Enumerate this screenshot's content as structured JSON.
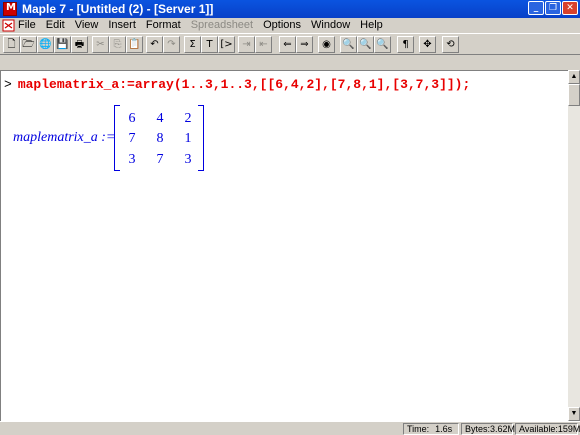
{
  "window": {
    "title": "Maple 7 - [Untitled (2) - [Server 1]]",
    "min_glyph": "_",
    "max_glyph": "❐",
    "close_glyph": "✕"
  },
  "menubar": {
    "items": [
      {
        "label": "File",
        "enabled": true
      },
      {
        "label": "Edit",
        "enabled": true
      },
      {
        "label": "View",
        "enabled": true
      },
      {
        "label": "Insert",
        "enabled": true
      },
      {
        "label": "Format",
        "enabled": true
      },
      {
        "label": "Spreadsheet",
        "enabled": false
      },
      {
        "label": "Options",
        "enabled": true
      },
      {
        "label": "Window",
        "enabled": true
      },
      {
        "label": "Help",
        "enabled": true
      }
    ]
  },
  "toolbar": {
    "tools": [
      {
        "name": "new-icon",
        "glyph": "🗋"
      },
      {
        "name": "open-icon",
        "glyph": "🗁"
      },
      {
        "name": "open-url-icon",
        "glyph": "🌐"
      },
      {
        "name": "save-icon",
        "glyph": "💾"
      },
      {
        "name": "print-icon",
        "glyph": "🖶"
      },
      {
        "name": "cut-icon",
        "glyph": "✂"
      },
      {
        "name": "copy-icon",
        "glyph": "⎘"
      },
      {
        "name": "paste-icon",
        "glyph": "📋"
      },
      {
        "name": "undo-icon",
        "glyph": "↶"
      },
      {
        "name": "redo-icon",
        "glyph": "↷"
      },
      {
        "name": "math-input-icon",
        "glyph": "Σ"
      },
      {
        "name": "text-input-icon",
        "glyph": "T"
      },
      {
        "name": "insert-prompt-icon",
        "glyph": "[>"
      },
      {
        "name": "indent-icon",
        "glyph": "⇥"
      },
      {
        "name": "outdent-icon",
        "glyph": "⇤"
      },
      {
        "name": "back-icon",
        "glyph": "⇐"
      },
      {
        "name": "forward-icon",
        "glyph": "⇒"
      },
      {
        "name": "stop-icon",
        "glyph": "◉"
      },
      {
        "name": "zoom-small-icon",
        "glyph": "🔍"
      },
      {
        "name": "zoom-medium-icon",
        "glyph": "🔍"
      },
      {
        "name": "zoom-large-icon",
        "glyph": "🔍"
      },
      {
        "name": "show-invisible-icon",
        "glyph": "¶"
      },
      {
        "name": "expand-sections-icon",
        "glyph": "✥"
      },
      {
        "name": "restart-icon",
        "glyph": "⟲"
      }
    ]
  },
  "worksheet": {
    "prompt": ">",
    "command": "maplematrix_a:=array(1..3,1..3,[[6,4,2],[7,8,1],[3,7,3]]);",
    "output_lhs": "maplematrix_a :=",
    "matrix": [
      [
        "6",
        "4",
        "2"
      ],
      [
        "7",
        "8",
        "1"
      ],
      [
        "3",
        "7",
        "3"
      ]
    ]
  },
  "statusbar": {
    "time_label": "Time:",
    "time_value": "1.6s",
    "bytes_label": "Bytes:",
    "bytes_value": "3.62M",
    "available_label": "Available:",
    "available_value": "159M"
  }
}
